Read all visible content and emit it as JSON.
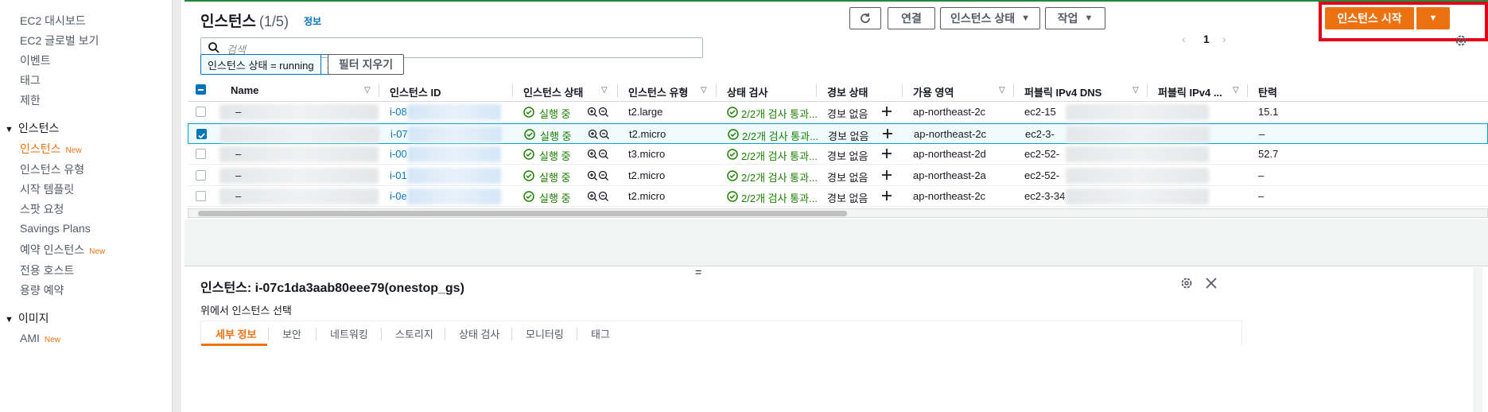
{
  "sidebar": {
    "items": [
      {
        "label": "EC2 대시보드"
      },
      {
        "label": "EC2 글로벌 보기"
      },
      {
        "label": "이벤트"
      },
      {
        "label": "태그"
      },
      {
        "label": "제한"
      }
    ],
    "section_instances": "인스턴스",
    "instance_items": [
      {
        "label": "인스턴스",
        "badge": "New"
      },
      {
        "label": "인스턴스 유형"
      },
      {
        "label": "시작 템플릿"
      },
      {
        "label": "스팟 요청"
      },
      {
        "label": "Savings Plans"
      },
      {
        "label": "예약 인스턴스",
        "badge": "New"
      },
      {
        "label": "전용 호스트"
      },
      {
        "label": "용량 예약"
      }
    ],
    "section_images": "이미지",
    "image_items": [
      {
        "label": "AMI",
        "badge": "New"
      }
    ]
  },
  "header": {
    "title": "인스턴스",
    "count": "(1/5)",
    "info": "정보",
    "connect_label": "연결",
    "instance_state_label": "인스턴스 상태",
    "actions_label": "작업",
    "launch_label": "인스턴스 시작",
    "page_number": "1"
  },
  "search": {
    "placeholder": "검색",
    "filter_chip": "인스턴스 상태 = running",
    "clear_filters": "필터 지우기"
  },
  "table": {
    "columns": [
      "Name",
      "인스턴스 ID",
      "인스턴스 상태",
      "인스턴스 유형",
      "상태 검사",
      "경보 상태",
      "가용 영역",
      "퍼블릭 IPv4 DNS",
      "퍼블릭 IPv4 ...",
      "탄력"
    ],
    "rows": [
      {
        "name": "–",
        "id": "i-08",
        "state": "실행 중",
        "type": "t2.large",
        "check": "2/2개 검사 통과...",
        "alarm": "경보 없음",
        "az": "ap-northeast-2c",
        "dns": "ec2-15",
        "ip": "15.1",
        "selected": false
      },
      {
        "name": "",
        "id": "i-07",
        "state": "실행 중",
        "type": "t2.micro",
        "check": "2/2개 검사 통과...",
        "alarm": "경보 없음",
        "az": "ap-northeast-2c",
        "dns": "ec2-3-",
        "ip": "–",
        "selected": true
      },
      {
        "name": "–",
        "id": "i-00",
        "state": "실행 중",
        "type": "t3.micro",
        "check": "2/2개 검사 통과...",
        "alarm": "경보 없음",
        "az": "ap-northeast-2d",
        "dns": "ec2-52-",
        "ip": "52.7",
        "selected": false
      },
      {
        "name": "–",
        "id": "i-01",
        "state": "실행 중",
        "type": "t2.micro",
        "check": "2/2개 검사 통과...",
        "alarm": "경보 없음",
        "az": "ap-northeast-2a",
        "dns": "ec2-52-",
        "ip": "–",
        "selected": false
      },
      {
        "name": "–",
        "id": "i-0e",
        "state": "실행 중",
        "type": "t2.micro",
        "check": "2/2개 검사 통과...",
        "alarm": "경보 없음",
        "az": "ap-northeast-2c",
        "dns": "ec2-3-34",
        "ip": "–",
        "selected": false
      }
    ]
  },
  "detail": {
    "title": "인스턴스: i-07c1da3aab80eee79(onestop_gs)",
    "subtitle": "위에서 인스턴스 선택",
    "tabs": [
      "세부 정보",
      "보안",
      "네트워킹",
      "스토리지",
      "상태 검사",
      "모니터링",
      "태그"
    ]
  },
  "colors": {
    "accent": "#ec7211",
    "link": "#0073bb",
    "success": "#1d8102",
    "highlight": "#e0001a"
  }
}
